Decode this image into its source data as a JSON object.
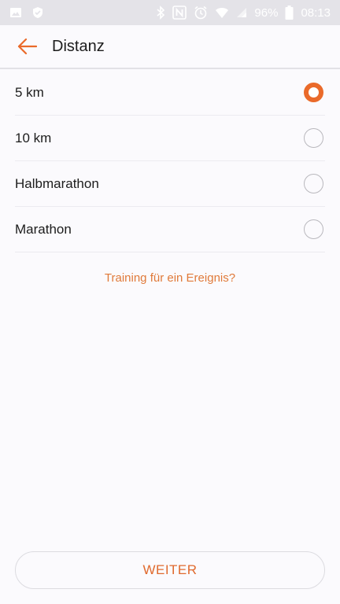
{
  "status_bar": {
    "battery_percent": "96%",
    "time": "08:13"
  },
  "header": {
    "title": "Distanz"
  },
  "options": [
    {
      "label": "5 km",
      "selected": true
    },
    {
      "label": "10 km",
      "selected": false
    },
    {
      "label": "Halbmarathon",
      "selected": false
    },
    {
      "label": "Marathon",
      "selected": false
    }
  ],
  "event_link": "Training für ein Ereignis?",
  "next_button": "WEITER",
  "colors": {
    "accent": "#ea6a2a",
    "background": "#fbfafd",
    "status_bar": "#e4e3e8"
  }
}
